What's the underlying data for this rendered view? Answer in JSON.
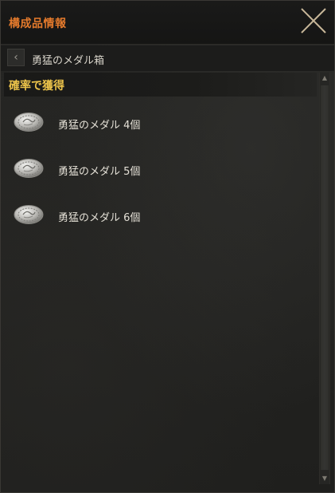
{
  "window": {
    "title": "構成品情報"
  },
  "breadcrumb": {
    "label": "勇猛のメダル箱"
  },
  "section": {
    "title": "確率で獲得"
  },
  "items": [
    {
      "label": "勇猛のメダル 4個",
      "icon": "silver-medal-icon"
    },
    {
      "label": "勇猛のメダル 5個",
      "icon": "silver-medal-icon"
    },
    {
      "label": "勇猛のメダル 6個",
      "icon": "silver-medal-icon"
    }
  ],
  "colors": {
    "title": "#e47a2c",
    "section_title": "#ebc24a",
    "text": "#e4e0d6",
    "background": "#232321"
  }
}
